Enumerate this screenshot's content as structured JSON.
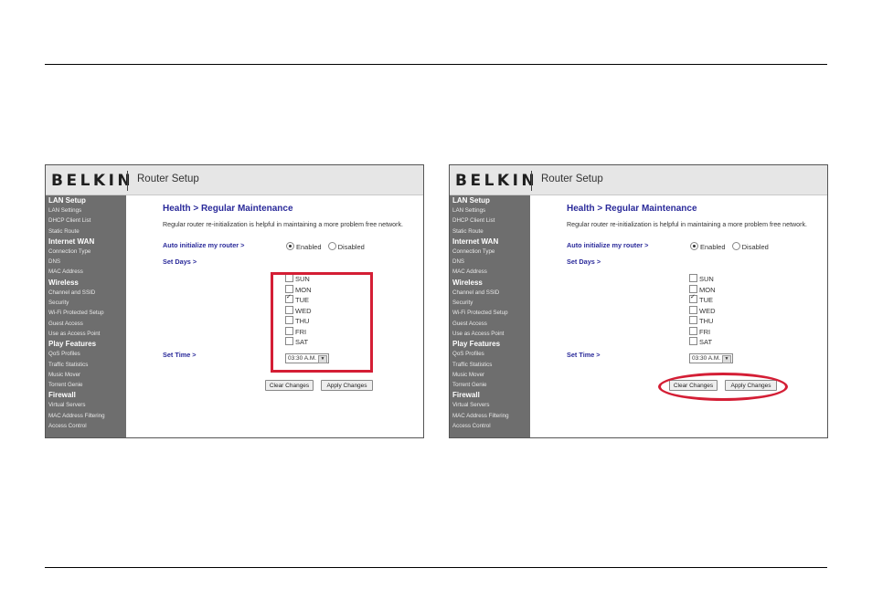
{
  "brand": "BELKIN",
  "app_title": "Router Setup",
  "sidebar": [
    {
      "label": "LAN Setup",
      "type": "section"
    },
    {
      "label": "LAN Settings",
      "type": "item"
    },
    {
      "label": "DHCP Client List",
      "type": "item"
    },
    {
      "label": "Static Route",
      "type": "item"
    },
    {
      "label": "Internet WAN",
      "type": "section"
    },
    {
      "label": "Connection Type",
      "type": "item"
    },
    {
      "label": "DNS",
      "type": "item"
    },
    {
      "label": "MAC Address",
      "type": "item"
    },
    {
      "label": "Wireless",
      "type": "section"
    },
    {
      "label": "Channel and SSID",
      "type": "item"
    },
    {
      "label": "Security",
      "type": "item"
    },
    {
      "label": "Wi-Fi Protected Setup",
      "type": "item"
    },
    {
      "label": "Guest Access",
      "type": "item"
    },
    {
      "label": "Use as Access Point",
      "type": "item"
    },
    {
      "label": "Play Features",
      "type": "section"
    },
    {
      "label": "QoS Profiles",
      "type": "item"
    },
    {
      "label": "Traffic Statistics",
      "type": "item"
    },
    {
      "label": "Music Mover",
      "type": "item"
    },
    {
      "label": "Torrent Genie",
      "type": "item"
    },
    {
      "label": "Firewall",
      "type": "section"
    },
    {
      "label": "Virtual Servers",
      "type": "item"
    },
    {
      "label": "MAC Address Filtering",
      "type": "item"
    },
    {
      "label": "Access Control",
      "type": "item"
    }
  ],
  "page": {
    "title": "Health > Regular Maintenance",
    "description": "Regular router re-initialization is helpful in maintaining a more problem free network.",
    "auto_label": "Auto initialize my router >",
    "enabled_label": "Enabled",
    "disabled_label": "Disabled",
    "auto_selected": "Enabled",
    "set_days_label": "Set Days >",
    "days": [
      {
        "label": "SUN",
        "checked": false
      },
      {
        "label": "MON",
        "checked": false
      },
      {
        "label": "TUE",
        "checked": true
      },
      {
        "label": "WED",
        "checked": false
      },
      {
        "label": "THU",
        "checked": false
      },
      {
        "label": "FRI",
        "checked": false
      },
      {
        "label": "SAT",
        "checked": false
      }
    ],
    "set_time_label": "Set Time >",
    "time_value": "03:30 A.M.",
    "clear_button": "Clear Changes",
    "apply_button": "Apply Changes"
  },
  "annotations": {
    "color": "#d41e35"
  }
}
